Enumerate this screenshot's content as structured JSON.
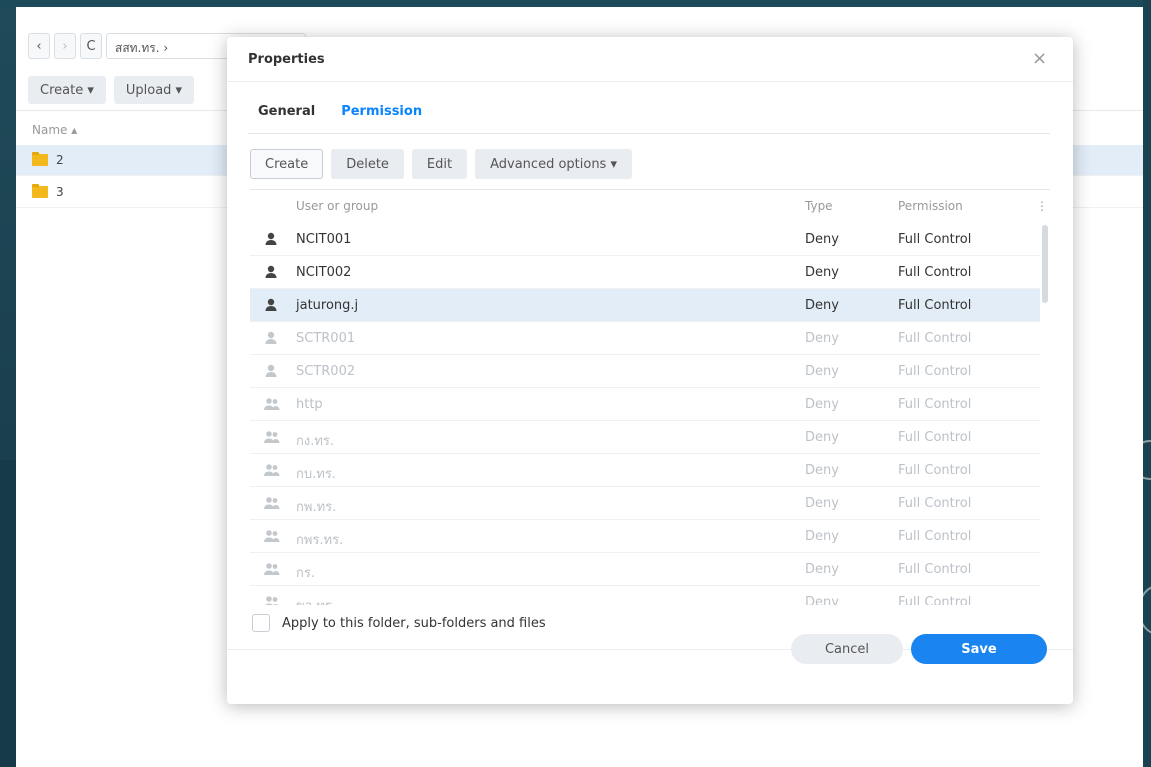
{
  "file_manager": {
    "nav_back": "‹",
    "nav_forward": "›",
    "refresh": "C",
    "path": "สสท.ทร. ›",
    "create_label": "Create ▾",
    "upload_label": "Upload ▾",
    "name_header": "Name ▴",
    "rows": [
      "2",
      "3"
    ]
  },
  "dialog": {
    "title": "Properties",
    "close": "×",
    "tabs": [
      "General",
      "Permission"
    ],
    "active_tab": "Permission",
    "buttons": {
      "create": "Create",
      "delete": "Delete",
      "edit": "Edit",
      "advanced": "Advanced options ▾"
    },
    "columns": {
      "user": "User or group",
      "type": "Type",
      "permission": "Permission",
      "menu": "⋮"
    },
    "entries": [
      {
        "name": "NCIT001",
        "type": "Deny",
        "permission": "Full Control",
        "kind": "user",
        "state": "normal"
      },
      {
        "name": "NCIT002",
        "type": "Deny",
        "permission": "Full Control",
        "kind": "user",
        "state": "normal"
      },
      {
        "name": "jaturong.j",
        "type": "Deny",
        "permission": "Full Control",
        "kind": "user",
        "state": "selected"
      },
      {
        "name": "SCTR001",
        "type": "Deny",
        "permission": "Full Control",
        "kind": "user",
        "state": "dim"
      },
      {
        "name": "SCTR002",
        "type": "Deny",
        "permission": "Full Control",
        "kind": "user",
        "state": "dim"
      },
      {
        "name": "http",
        "type": "Deny",
        "permission": "Full Control",
        "kind": "group",
        "state": "dim"
      },
      {
        "name": "กง.ทร.",
        "type": "Deny",
        "permission": "Full Control",
        "kind": "group",
        "state": "dim"
      },
      {
        "name": "กบ.ทร.",
        "type": "Deny",
        "permission": "Full Control",
        "kind": "group",
        "state": "dim"
      },
      {
        "name": "กพ.ทร.",
        "type": "Deny",
        "permission": "Full Control",
        "kind": "group",
        "state": "dim"
      },
      {
        "name": "กพร.ทร.",
        "type": "Deny",
        "permission": "Full Control",
        "kind": "group",
        "state": "dim"
      },
      {
        "name": "กร.",
        "type": "Deny",
        "permission": "Full Control",
        "kind": "group",
        "state": "dim"
      },
      {
        "name": "ขว.ทร.",
        "type": "Deny",
        "permission": "Full Control",
        "kind": "group",
        "state": "dim"
      }
    ],
    "apply_label": "Apply to this folder, sub-folders and files",
    "cancel_label": "Cancel",
    "save_label": "Save"
  },
  "colors": {
    "accent": "#1a85f0",
    "selected_row": "#e3edf8",
    "folder": "#f3b81c"
  }
}
